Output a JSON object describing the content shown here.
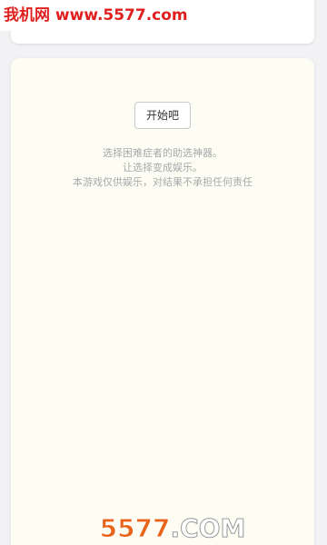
{
  "watermark": {
    "top_text": "我机网 www.5577.com",
    "bottom_number": "5577",
    "bottom_domain": ".COM"
  },
  "main": {
    "start_button_label": "开始吧",
    "description": [
      "选择困难症者的助选神器。",
      "让选择变成娱乐。",
      "本游戏仅供娱乐，对结果不承担任何责任"
    ]
  },
  "colors": {
    "card_background": "#fdfdf3",
    "watermark_red": "#e0201e",
    "watermark_orange": "#e8641b"
  }
}
